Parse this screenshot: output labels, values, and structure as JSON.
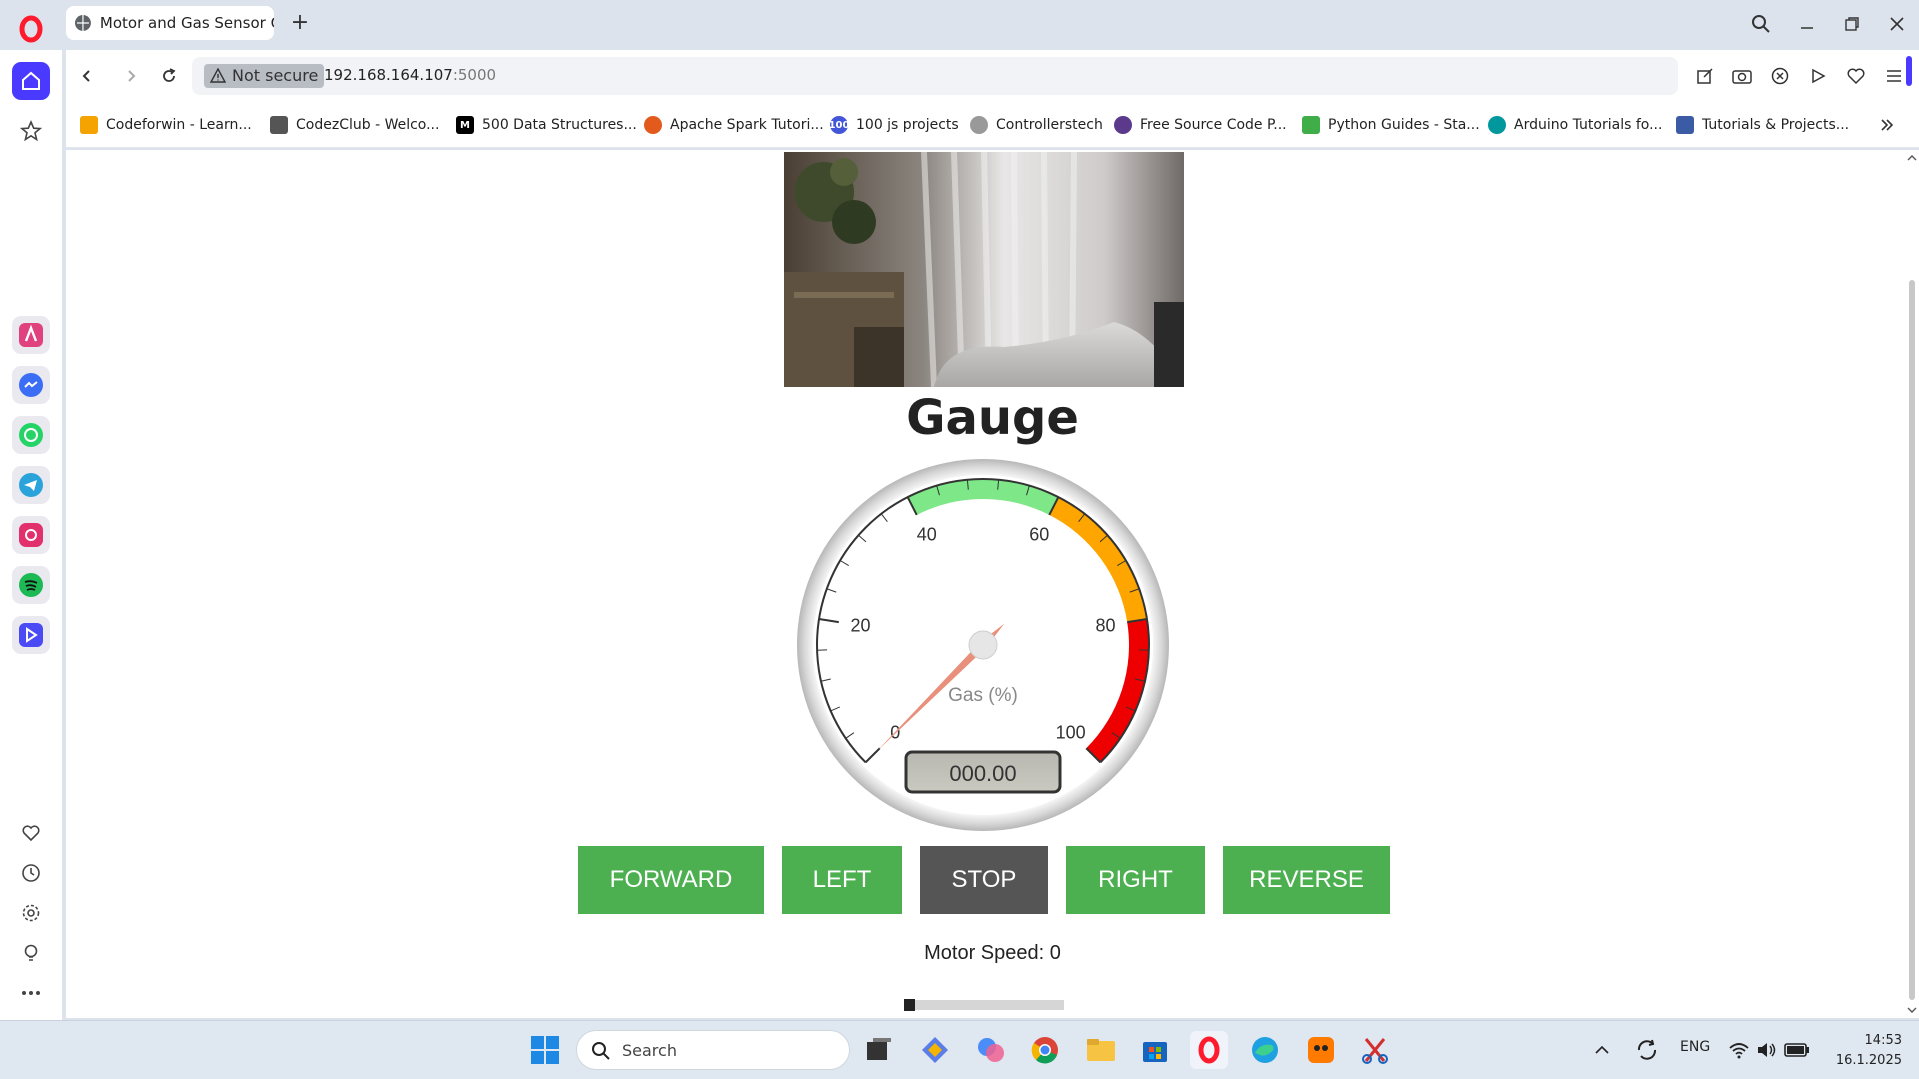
{
  "browser": {
    "tab_title": "Motor and Gas Sensor Control",
    "new_tab_symbol": "+",
    "address": {
      "not_secure_label": "Not secure",
      "host": "192.168.164.107",
      "port": ":5000"
    },
    "bookmarks": [
      {
        "label": "Codeforwin - Learn...",
        "icon": "codeforwin-icon",
        "color": "#f5a300"
      },
      {
        "label": "CodezClub - Welco...",
        "icon": "document-icon",
        "color": "#555555"
      },
      {
        "label": "500 Data Structures...",
        "icon": "medium-icon",
        "color": "#000000"
      },
      {
        "label": "Apache Spark Tutori...",
        "icon": "spark-icon",
        "color": "#e25a1c"
      },
      {
        "label": "100 js projects",
        "icon": "js100-icon",
        "color": "#4456d8"
      },
      {
        "label": "Controllerstech",
        "icon": "controllerstech-icon",
        "color": "#999999"
      },
      {
        "label": "Free Source Code P...",
        "icon": "sourcecode-icon",
        "color": "#5b3a8c"
      },
      {
        "label": "Python Guides - Sta...",
        "icon": "pythonguides-icon",
        "color": "#3fae49"
      },
      {
        "label": "Arduino Tutorials fo...",
        "icon": "arduino-icon",
        "color": "#00979d"
      },
      {
        "label": "Tutorials & Projects...",
        "icon": "tutorials-icon",
        "color": "#3b5ba5"
      }
    ]
  },
  "page": {
    "gauge_title": "Gauge",
    "gauge": {
      "label": "Gas (%)",
      "readout": "000.00",
      "value": 0,
      "min": 0,
      "max": 100,
      "major_ticks": [
        "0",
        "20",
        "40",
        "60",
        "80",
        "100"
      ],
      "zones": [
        {
          "from": 40,
          "to": 60,
          "color": "#7ee787"
        },
        {
          "from": 60,
          "to": 80,
          "color": "#ffa500"
        },
        {
          "from": 80,
          "to": 100,
          "color": "#ee0000"
        }
      ]
    },
    "controls": {
      "forward": "FORWARD",
      "left": "LEFT",
      "stop": "STOP",
      "right": "RIGHT",
      "reverse": "REVERSE"
    },
    "motor_speed_label": "Motor Speed: 0",
    "motor_speed_value": 0,
    "motor_speed_max": 100
  },
  "taskbar": {
    "search_label": "Search",
    "language": "ENG",
    "time": "14:53",
    "date": "16.1.2025"
  },
  "colors": {
    "button_green": "#4caf50",
    "button_stop": "#555555",
    "opera_red": "#ff1b2d",
    "sidebar_active": "#4a3aff"
  }
}
